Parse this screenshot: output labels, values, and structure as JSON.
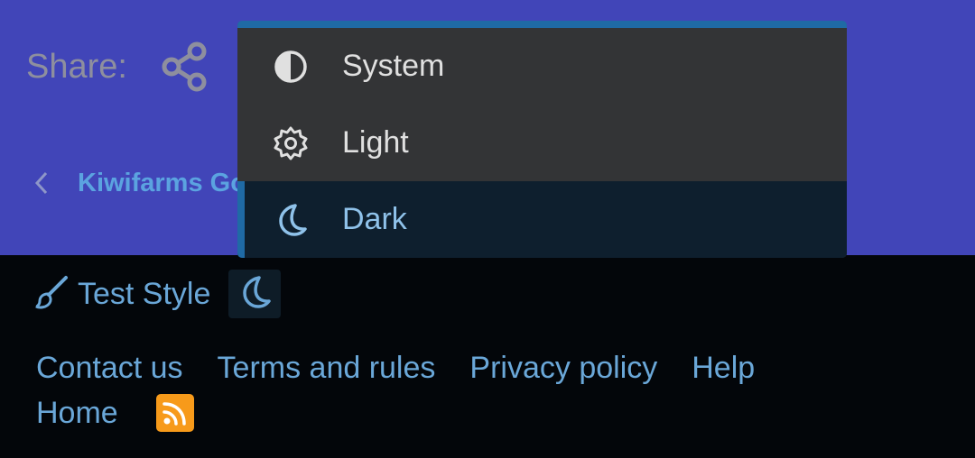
{
  "share": {
    "label": "Share:",
    "icon": "share-icon"
  },
  "breadcrumb": {
    "icon": "chevron-left-icon",
    "label": "Kiwifarms Go"
  },
  "theme_menu": {
    "items": [
      {
        "label": "System",
        "icon": "half-circle-icon",
        "active": false
      },
      {
        "label": "Light",
        "icon": "gear-icon",
        "active": false
      },
      {
        "label": "Dark",
        "icon": "moon-icon",
        "active": true
      }
    ]
  },
  "footer": {
    "style_label": "Test Style",
    "style_icon": "paintbrush-icon",
    "theme_toggle_icon": "moon-icon",
    "links": [
      "Contact us",
      "Terms and rules",
      "Privacy policy",
      "Help"
    ],
    "home_label": "Home",
    "rss_icon": "rss-icon"
  },
  "colors": {
    "header_bg": "#4145b8",
    "footer_bg": "#03060a",
    "menu_bg": "#333436",
    "menu_active_bg": "#0e1f2e",
    "accent": "#1f6aa5",
    "link": "#6aa7d8",
    "rss": "#f79a1a"
  }
}
